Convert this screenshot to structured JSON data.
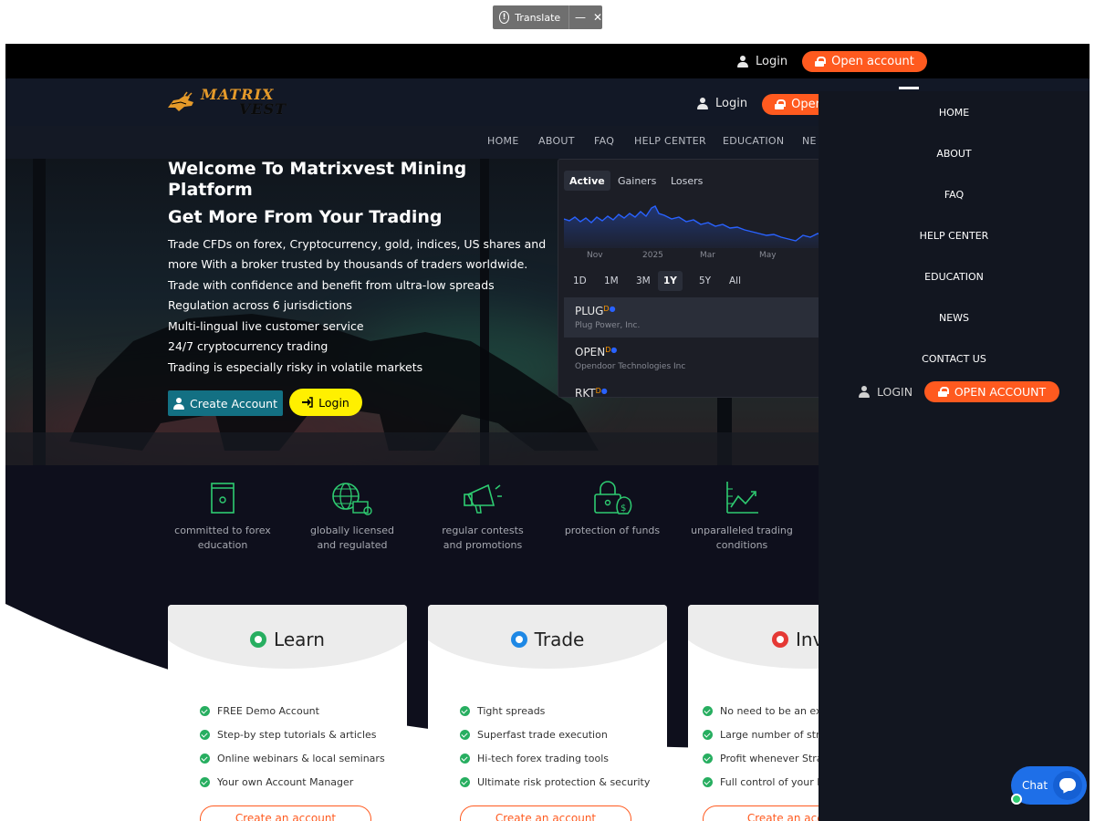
{
  "translate": {
    "label": "Translate",
    "minimize": "—",
    "close": "✕"
  },
  "topbar": {
    "login": "Login",
    "open_account": "Open account"
  },
  "header": {
    "logo_line1": "MATRIX",
    "logo_line2": "VEST",
    "login": "Login",
    "open_account": "Open account"
  },
  "nav": {
    "items": [
      "HOME",
      "ABOUT",
      "FAQ",
      "HELP CENTER",
      "EDUCATION",
      "NE"
    ]
  },
  "hero": {
    "title_line1": "Welcome To Matrixvest Mining",
    "title_line2": "Platform",
    "subtitle": "Get More From Your Trading",
    "lines": [
      "Trade CFDs on forex, Cryptocurrency, gold, indices, US shares and",
      "more With a broker trusted by thousands of traders worldwide.",
      "Trade with confidence and benefit from ultra-low spreads",
      "Regulation across 6 jurisdictions",
      "Multi-lingual live customer service",
      "24/7 cryptocurrency trading",
      "Trading is especially risky in volatile markets"
    ],
    "create_account": "Create Account",
    "login": "Login"
  },
  "widget": {
    "tabs": [
      "Active",
      "Gainers",
      "Losers"
    ],
    "x_labels": [
      "Nov",
      "2025",
      "Mar",
      "May"
    ],
    "ranges": [
      "1D",
      "1M",
      "3M",
      "1Y",
      "5Y",
      "All"
    ],
    "rows": [
      {
        "symbol": "PLUG",
        "sup": "D",
        "name": "Plug Power, Inc."
      },
      {
        "symbol": "OPEN",
        "sup": "D",
        "name": "Opendoor Technologies Inc"
      },
      {
        "symbol": "RKT",
        "sup": "D",
        "name": ""
      }
    ]
  },
  "features": [
    {
      "l1": "committed to forex",
      "l2": "education",
      "icon": "book-icon"
    },
    {
      "l1": "globally licensed",
      "l2": "and regulated",
      "icon": "globe-certificate-icon"
    },
    {
      "l1": "regular contests",
      "l2": "and promotions",
      "icon": "megaphone-icon"
    },
    {
      "l1": "protection of funds",
      "l2": "",
      "icon": "lock-money-icon"
    },
    {
      "l1": "unparalleled trading",
      "l2": "conditions",
      "icon": "growth-chart-icon"
    }
  ],
  "cards": [
    {
      "title": "Learn",
      "dot": "#27ae60",
      "items": [
        "FREE Demo Account",
        "Step-by step tutorials & articles",
        "Online webinars & local seminars",
        "Your own Account Manager"
      ],
      "button": "Create an account"
    },
    {
      "title": "Trade",
      "dot": "#1e88e5",
      "items": [
        "Tight spreads",
        "Superfast trade execution",
        "Hi-tech forex trading tools",
        "Ultimate risk protection & security"
      ],
      "button": "Create an account"
    },
    {
      "title": "Inv",
      "dot": "#e53935",
      "items": [
        "No need to be an exp",
        "Large number of stra",
        "Profit whenever Strat",
        "Full control of your In"
      ],
      "button": "Create an acco"
    }
  ],
  "menu": {
    "items": [
      "HOME",
      "ABOUT",
      "FAQ",
      "HELP CENTER",
      "EDUCATION",
      "NEWS",
      "CONTACT US"
    ],
    "login": "LOGIN",
    "open_account": "OPEN ACCOUNT"
  },
  "chat": {
    "label": "Chat"
  },
  "colors": {
    "accent": "#ff5a1f",
    "teal": "#137083",
    "yellow": "#fff000",
    "feature_green": "#2ecc71"
  }
}
